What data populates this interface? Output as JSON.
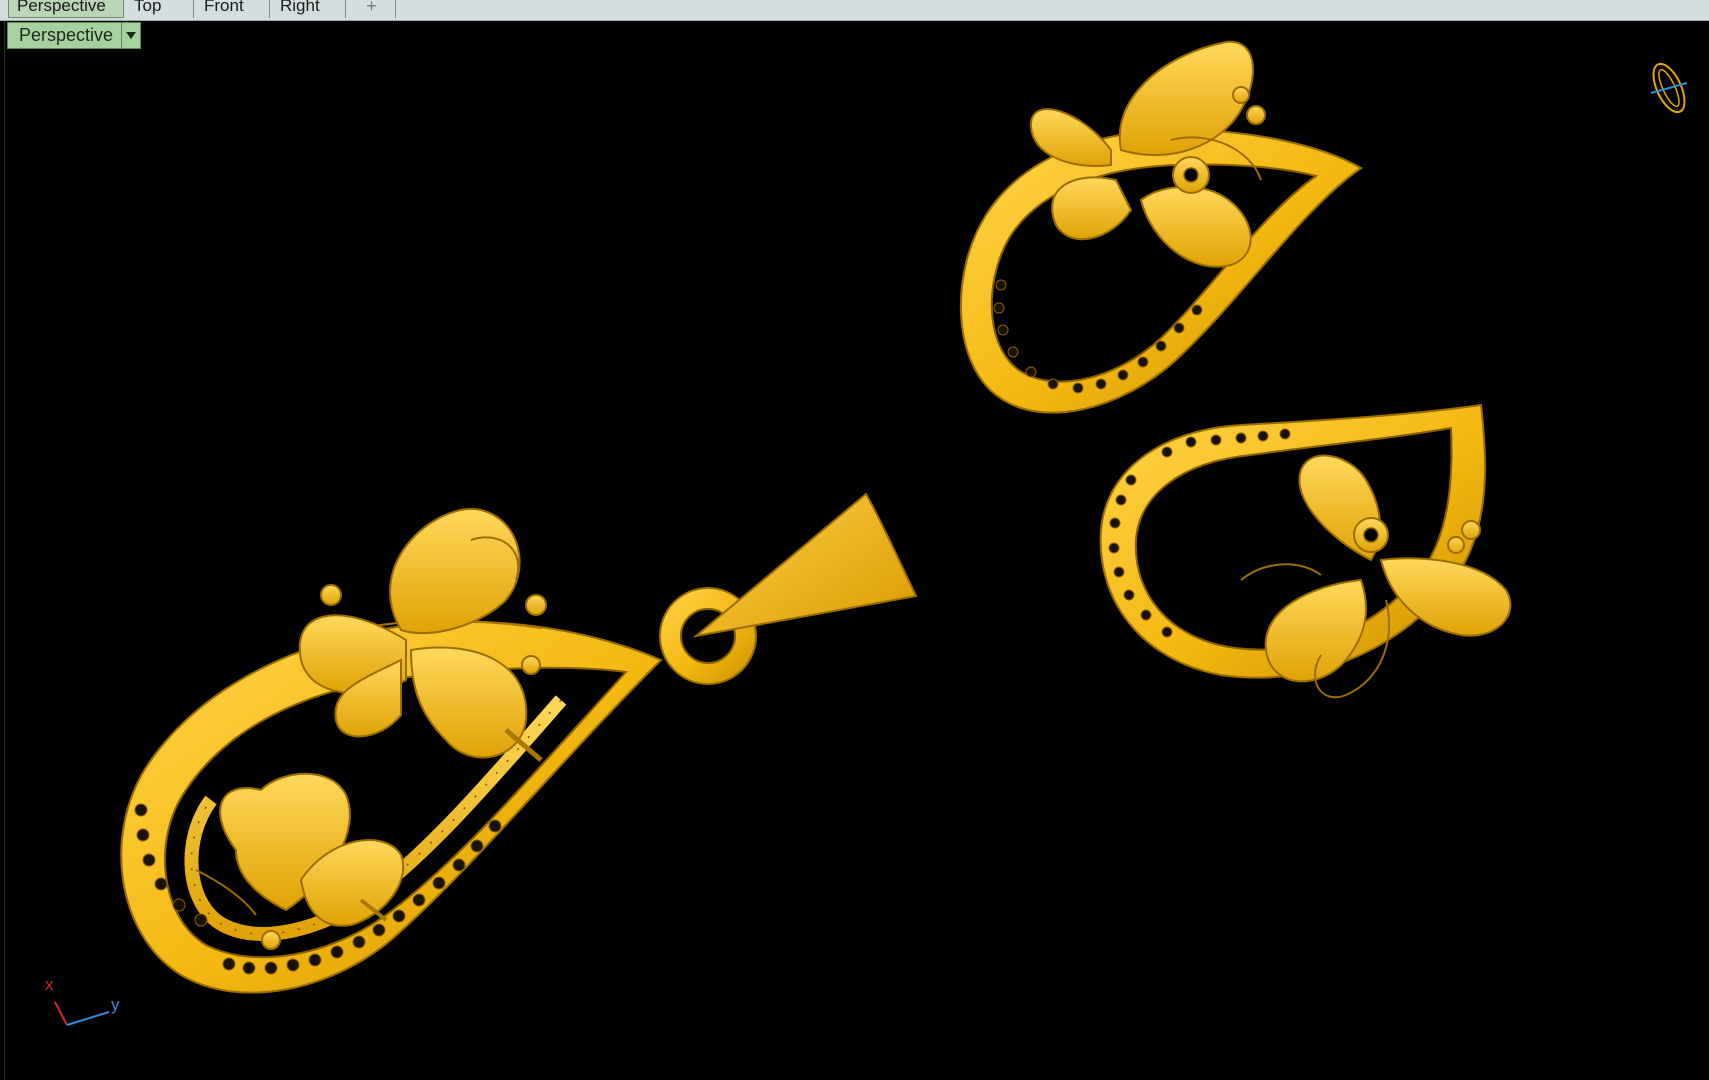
{
  "viewport_tabs": [
    {
      "label": "Perspective",
      "active": true
    },
    {
      "label": "Top",
      "active": false
    },
    {
      "label": "Front",
      "active": false
    },
    {
      "label": "Right",
      "active": false
    }
  ],
  "add_tab_glyph": "+",
  "viewport": {
    "label": "Perspective",
    "dropdown_icon": "chevron-down-icon",
    "background": "#000000"
  },
  "model": {
    "material_color": "#f4b811",
    "shade_color": "#b07f00",
    "highlight_color": "#ffd85a",
    "objects": [
      "pendant",
      "earring-top",
      "earring-right"
    ]
  },
  "axis_triad": {
    "x_label": "x",
    "y_label": "y",
    "x_color": "#d12a2a",
    "y_color": "#2e8bd8"
  },
  "nav_widget_icon": "view-rotate-icon"
}
